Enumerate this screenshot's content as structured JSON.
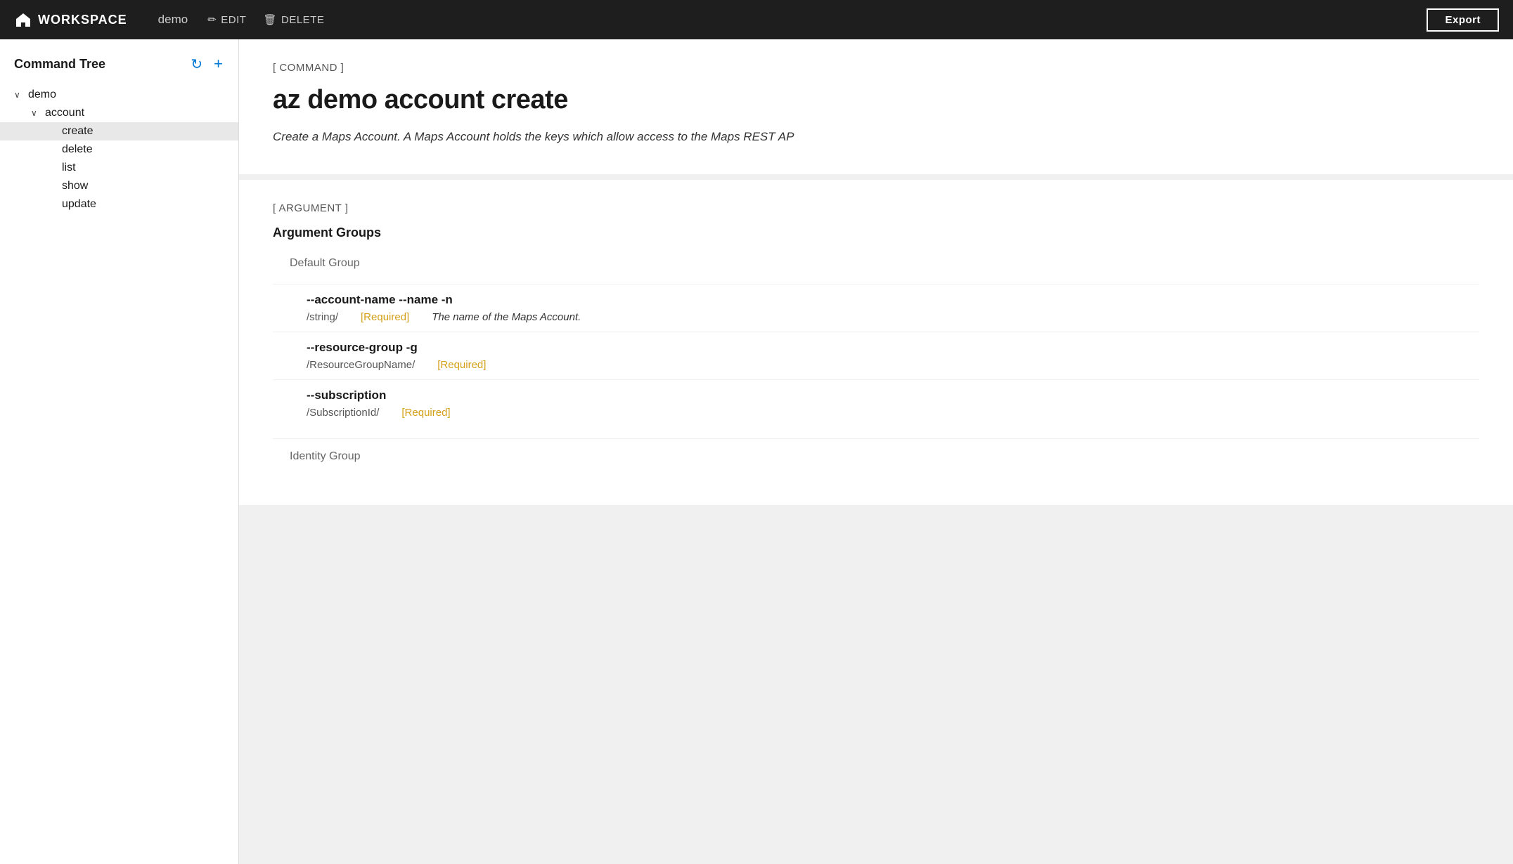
{
  "topbar": {
    "home_label": "WORKSPACE",
    "workspace_name": "demo",
    "edit_label": "EDIT",
    "delete_label": "DELETE",
    "export_label": "Export"
  },
  "sidebar": {
    "title": "Command Tree",
    "refresh_icon": "↻",
    "add_icon": "+",
    "tree": [
      {
        "id": "demo",
        "label": "demo",
        "level": 0,
        "expanded": true,
        "has_children": true
      },
      {
        "id": "account",
        "label": "account",
        "level": 1,
        "expanded": true,
        "has_children": true
      },
      {
        "id": "create",
        "label": "create",
        "level": 2,
        "selected": true,
        "has_children": false
      },
      {
        "id": "delete",
        "label": "delete",
        "level": 2,
        "has_children": false
      },
      {
        "id": "list",
        "label": "list",
        "level": 2,
        "has_children": false
      },
      {
        "id": "show",
        "label": "show",
        "level": 2,
        "has_children": false
      },
      {
        "id": "update",
        "label": "update",
        "level": 2,
        "has_children": false
      }
    ]
  },
  "command_section": {
    "section_label": "[ COMMAND ]",
    "command_title": "az demo account create",
    "command_desc": "Create a Maps Account. A Maps Account holds the keys which allow access to the Maps REST AP"
  },
  "argument_section": {
    "section_label": "[ ARGUMENT ]",
    "groups_title": "Argument Groups",
    "groups": [
      {
        "name": "Default Group",
        "args": [
          {
            "name": "--account-name --name -n",
            "type": "/string/",
            "required": "[Required]",
            "desc": "The name of the Maps Account."
          },
          {
            "name": "--resource-group -g",
            "type": "/ResourceGroupName/",
            "required": "[Required]",
            "desc": ""
          },
          {
            "name": "--subscription",
            "type": "/SubscriptionId/",
            "required": "[Required]",
            "desc": ""
          }
        ]
      },
      {
        "name": "Identity Group",
        "args": []
      }
    ]
  },
  "colors": {
    "required": "#d4a017",
    "topbar_bg": "#1e1e1e",
    "accent_blue": "#0078d4"
  }
}
